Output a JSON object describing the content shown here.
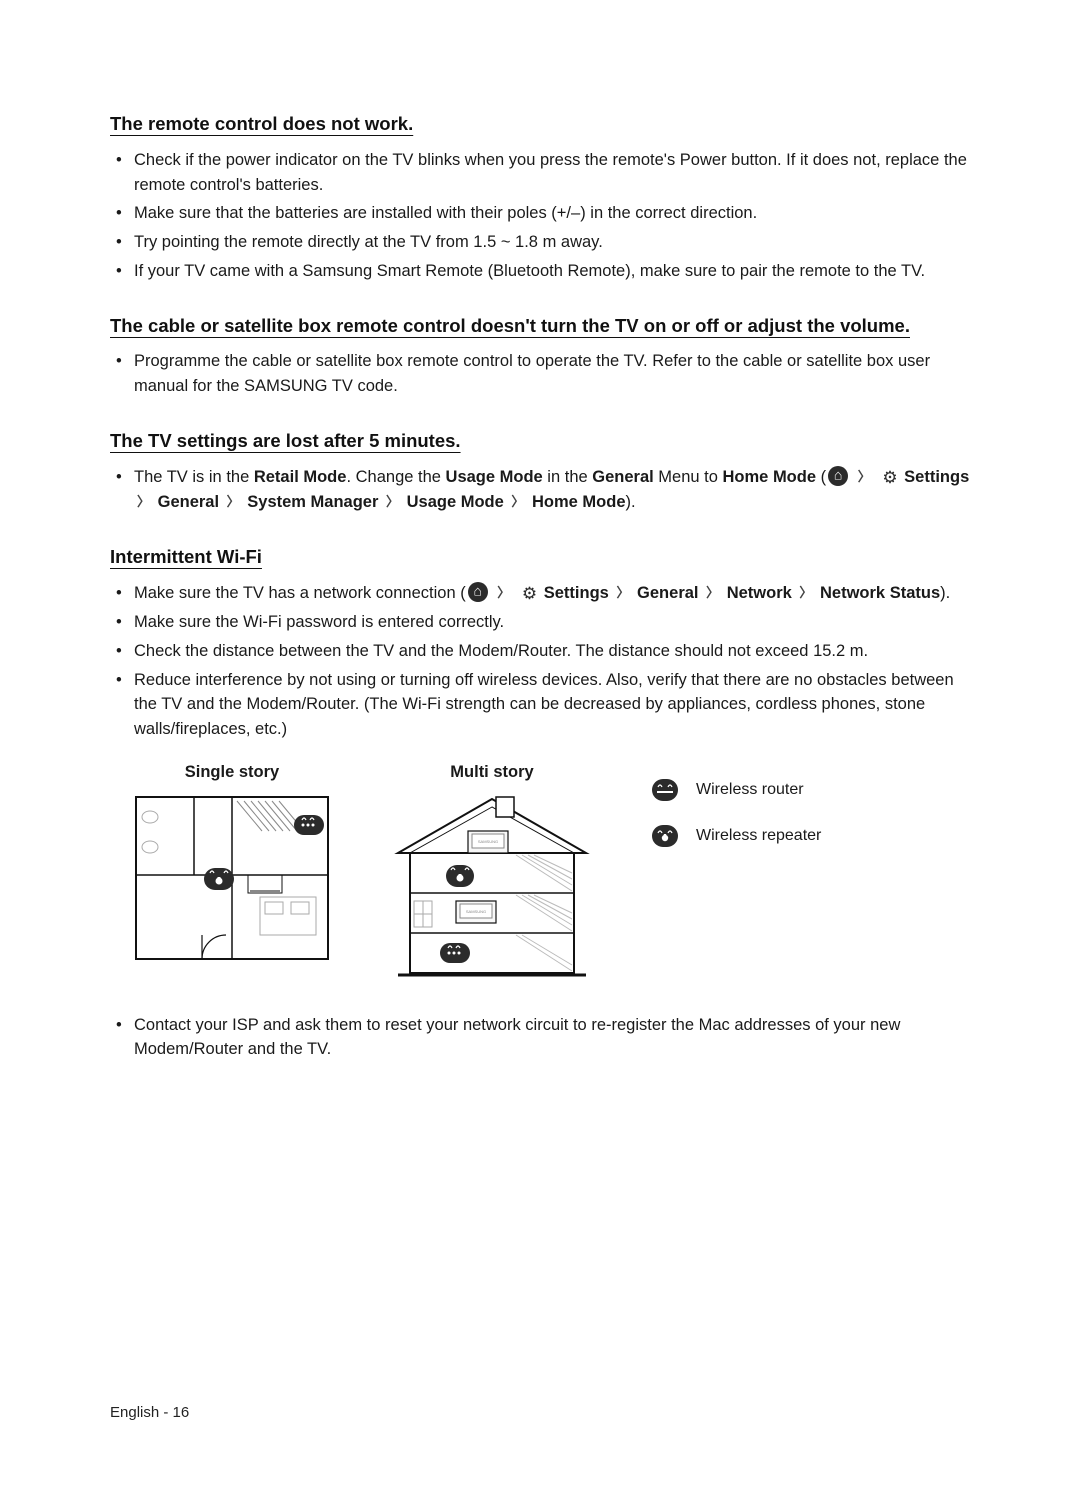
{
  "sections": [
    {
      "heading": "The remote control does not work.",
      "bullets": [
        "Check if the power indicator on the TV blinks when you press the remote's Power button. If it does not, replace the remote control's batteries.",
        "Make sure that the batteries are installed with their poles (+/–) in the correct direction.",
        "Try pointing the remote directly at the TV from 1.5 ~ 1.8 m away.",
        "If your TV came with a Samsung Smart Remote (Bluetooth Remote), make sure to pair the remote to the TV."
      ]
    },
    {
      "heading": "The cable or satellite box remote control doesn't turn the TV on or off or adjust the volume.",
      "bullets": [
        "Programme the cable or satellite box remote control to operate the TV. Refer to the cable or satellite box user manual for the SAMSUNG TV code."
      ]
    },
    {
      "heading": "The TV settings are lost after 5 minutes.",
      "retail": {
        "prefix": "The TV is in the ",
        "retail_mode": "Retail Mode",
        "mid1": ". Change the ",
        "usage_mode": "Usage Mode",
        "mid2": " in the ",
        "general1": "General",
        "mid3": " Menu to ",
        "home_mode1": "Home Mode",
        "open": " (",
        "settings": "Settings",
        "general2": "General",
        "system_manager": "System Manager",
        "usage_mode2": "Usage Mode",
        "home_mode2": "Home Mode",
        "close": ")."
      }
    },
    {
      "heading": "Intermittent Wi-Fi",
      "wifi1": {
        "prefix": "Make sure the TV has a network connection (",
        "settings": "Settings",
        "general": "General",
        "network": "Network",
        "network_status": "Network Status",
        "close": ")."
      },
      "bullets_rest": [
        "Make sure the Wi-Fi password is entered correctly.",
        "Check the distance between the TV and the Modem/Router. The distance should not exceed 15.2 m.",
        "Reduce interference by not using or turning off wireless devices. Also, verify that there are no obstacles between the TV and the Modem/Router. (The Wi-Fi strength can be decreased by appliances, cordless phones, stone walls/fireplaces, etc.)"
      ],
      "figures": {
        "single_title": "Single story",
        "multi_title": "Multi story",
        "legend_router": "Wireless router",
        "legend_repeater": "Wireless repeater"
      },
      "bullets_after": [
        "Contact your ISP and ask them to reset your network circuit to re-register the Mac addresses of your new Modem/Router and the TV."
      ]
    }
  ],
  "footer": "English - 16"
}
